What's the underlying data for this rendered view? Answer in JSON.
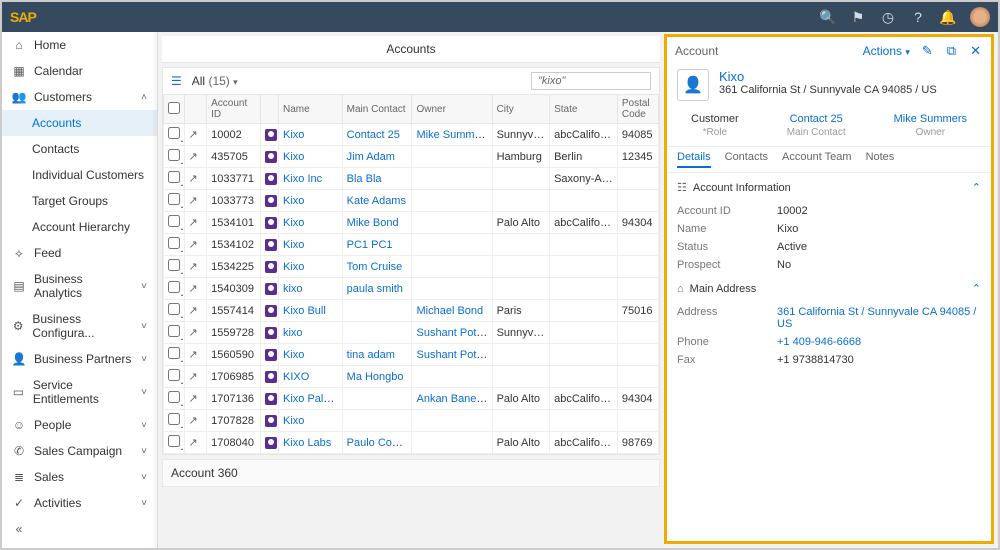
{
  "header": {
    "logo_main": "SAP"
  },
  "sidebar": {
    "items": [
      {
        "label": "Home",
        "icon": "⌂"
      },
      {
        "label": "Calendar",
        "icon": "▦"
      },
      {
        "label": "Customers",
        "icon": "👥",
        "expand": true,
        "children": [
          {
            "label": "Accounts",
            "active": true
          },
          {
            "label": "Contacts"
          },
          {
            "label": "Individual Customers"
          },
          {
            "label": "Target Groups"
          },
          {
            "label": "Account Hierarchy"
          }
        ]
      },
      {
        "label": "Feed",
        "icon": "⟡"
      },
      {
        "label": "Business Analytics",
        "icon": "▤",
        "expand": true
      },
      {
        "label": "Business Configura...",
        "icon": "⚙",
        "expand": true
      },
      {
        "label": "Business Partners",
        "icon": "👤",
        "expand": true
      },
      {
        "label": "Service Entitlements",
        "icon": "▭",
        "expand": true
      },
      {
        "label": "People",
        "icon": "☺",
        "expand": true
      },
      {
        "label": "Sales Campaign",
        "icon": "✆",
        "expand": true
      },
      {
        "label": "Sales",
        "icon": "≣",
        "expand": true
      },
      {
        "label": "Activities",
        "icon": "✓",
        "expand": true
      }
    ],
    "collapse": "«"
  },
  "page": {
    "title": "Accounts"
  },
  "worklist": {
    "filter": "All",
    "count": "(15)",
    "search": "\"kixo\"",
    "columns": [
      "",
      "",
      "Account ID",
      "",
      "Name",
      "Main Contact",
      "Owner",
      "City",
      "State",
      "Postal Code"
    ],
    "rows": [
      {
        "id": "10002",
        "name": "Kixo",
        "mc": "Contact 25",
        "owner": "Mike Summers",
        "city": "Sunnyvale",
        "state": "abcCalifornia",
        "zip": "94085"
      },
      {
        "id": "435705",
        "name": "Kixo",
        "mc": "Jim Adam",
        "owner": "",
        "city": "Hamburg",
        "state": "Berlin",
        "zip": "12345"
      },
      {
        "id": "1033771",
        "name": "Kixo Inc",
        "mc": "Bla Bla",
        "owner": "",
        "city": "",
        "state": "Saxony-Anhalt",
        "zip": ""
      },
      {
        "id": "1033773",
        "name": "Kixo",
        "mc": "Kate Adams",
        "owner": "",
        "city": "",
        "state": "",
        "zip": ""
      },
      {
        "id": "1534101",
        "name": "Kixo",
        "mc": "Mike Bond",
        "owner": "",
        "city": "Palo Alto",
        "state": "abcCalifornia",
        "zip": "94304"
      },
      {
        "id": "1534102",
        "name": "Kixo",
        "mc": "PC1 PC1",
        "owner": "",
        "city": "",
        "state": "",
        "zip": ""
      },
      {
        "id": "1534225",
        "name": "Kixo",
        "mc": "Tom Cruise",
        "owner": "",
        "city": "",
        "state": "",
        "zip": ""
      },
      {
        "id": "1540309",
        "name": "kixo",
        "mc": "paula smith",
        "owner": "",
        "city": "",
        "state": "",
        "zip": ""
      },
      {
        "id": "1557414",
        "name": "Kixo Bull",
        "mc": "",
        "owner": "Michael Bond",
        "city": "Paris",
        "state": "",
        "zip": "75016"
      },
      {
        "id": "1559728",
        "name": "kixo",
        "mc": "",
        "owner": "Sushant Potdar",
        "city": "Sunnyvale",
        "state": "",
        "zip": ""
      },
      {
        "id": "1560590",
        "name": "Kixo",
        "mc": "tina adam",
        "owner": "Sushant Potdar",
        "city": "",
        "state": "",
        "zip": ""
      },
      {
        "id": "1706985",
        "name": "KIXO",
        "mc": "Ma Hongbo",
        "owner": "",
        "city": "",
        "state": "",
        "zip": ""
      },
      {
        "id": "1707136",
        "name": "Kixo Palo ...",
        "mc": "",
        "owner": "Ankan Banerjee",
        "city": "Palo Alto",
        "state": "abcCalifornia",
        "zip": "94304"
      },
      {
        "id": "1707828",
        "name": "Kixo",
        "mc": "",
        "owner": "",
        "city": "",
        "state": "",
        "zip": ""
      },
      {
        "id": "1708040",
        "name": "Kixo Labs",
        "mc": "Paulo Coelho",
        "owner": "",
        "city": "Palo Alto",
        "state": "abcCalifornia",
        "zip": "98769"
      }
    ]
  },
  "section360": {
    "title": "Account 360"
  },
  "details": {
    "panel_title": "Account",
    "actions": "Actions",
    "name": "Kixo",
    "address": "361 California St / Sunnyvale CA 94085 / US",
    "facets": [
      {
        "val": "Customer",
        "lbl": "*Role"
      },
      {
        "val": "Contact 25",
        "lbl": "Main Contact",
        "link": true
      },
      {
        "val": "Mike Summers",
        "lbl": "Owner",
        "link": true
      }
    ],
    "tabs": [
      "Details",
      "Contacts",
      "Account Team",
      "Notes"
    ],
    "sec1": {
      "title": "Account Information",
      "rows": [
        {
          "lbl": "Account ID",
          "val": "10002"
        },
        {
          "lbl": "Name",
          "val": "Kixo"
        },
        {
          "lbl": "Status",
          "val": "Active"
        },
        {
          "lbl": "Prospect",
          "val": "No"
        }
      ]
    },
    "sec2": {
      "title": "Main Address",
      "rows": [
        {
          "lbl": "Address",
          "val": "361 California St / Sunnyvale CA 94085 / US",
          "link": true
        },
        {
          "lbl": "Phone",
          "val": "+1 409-946-6668",
          "link": true
        },
        {
          "lbl": "Fax",
          "val": "+1 9738814730"
        }
      ]
    }
  }
}
